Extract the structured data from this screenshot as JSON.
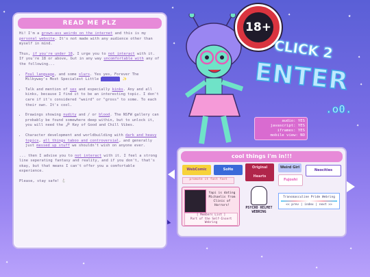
{
  "readme": {
    "title": "READ ME PLZ",
    "intro_a": "Hi! I'm a ",
    "intro_link1": "grown-ass weirdo on the internet",
    "intro_b": " and this is my ",
    "intro_link2": "personal website",
    "intro_c": ". It's not made with any audience other than myself in mind.",
    "thus_a": "Thus, ",
    "thus_link1": "if you're under 18",
    "thus_b": ", I urge you to ",
    "thus_link2": "not interact",
    "thus_c": " with it. If you're 18 or above, but in any way ",
    "thus_link3": "uncomfortable with",
    "thus_d": " any of the following...",
    "bullet1_a": "",
    "bullet1_link1": "Foul language",
    "bullet1_b": ", and some ",
    "bullet1_link2": "slurs",
    "bullet1_c": ". Yes yes, Forever The Milkyway's Most Specialest Little ",
    "bullet1_end": " ✨",
    "bullet2_a": "Talk and mention of ",
    "bullet2_link1": "sex",
    "bullet2_b": " and especially ",
    "bullet2_link2": "kinks",
    "bullet2_c": ". Any and all kinks, because I find it to be an interesting topic. I don't care if it's considered \"weird\" or \"gross\" to some. To each their own. It's cool.",
    "bullet3_a": "Drawings showing ",
    "bullet3_link1": "nudity",
    "bullet3_b": " and / or ",
    "bullet3_link2": "blood",
    "bullet3_c": ". The NSFW gallery can probably be found somewhere deep within, but to unlock it, you will need the 🗝 Key of Good and Chill Vibes.",
    "bullet4_a": "Character development and worldbuilding with ",
    "bullet4_link1": "dark and heavy topics",
    "bullet4_b": ", ",
    "bullet4_link2": "all things taboo and controversial",
    "bullet4_c": ", and generally just ",
    "bullet4_link3": "messed up stuff",
    "bullet4_d": " we shouldn't wish on anyone ever.",
    "then_a": "... then I advise you to ",
    "then_link": "not interact",
    "then_b": " with it. I feel a strong line seperating fantasy and reality, and if you don't, that's okay, but that means I can't offer you a comfortable experience.",
    "stay": "Please, stay safe! 🐇"
  },
  "badge": {
    "label": "18+"
  },
  "enter": {
    "click_to": "CLICK 2",
    "enter": "ENTER",
    "dots": ".o0.",
    "status_lines": [
      "audio: YES",
      "javascript: YES",
      "iframes: YES",
      "mobile view: NO"
    ]
  },
  "cool": {
    "title": "cool things i'm in!!!",
    "buttons": [
      "WebComic",
      "SoHo",
      "Original Hearts",
      "Fujoshi",
      "Weird Girl",
      "Neocities"
    ],
    "promo": "promote it fast fast",
    "yapi_text": "Yapi is dating Michaelis from Clinic of Horrors!",
    "yapi_foot_1": "[ Members List ]",
    "yapi_foot_2": "Part of the Self-Insert Webring",
    "psycho": "PSYCHO HELMET WEBRING",
    "trans_title": "Transmasculine Pride Webring",
    "trans_nav": "<< prev | index | next >>"
  },
  "colors": {
    "accent_pink": "#e78ad8",
    "bg_purple": "#6b67e0",
    "panel": "#f6f2fb"
  }
}
